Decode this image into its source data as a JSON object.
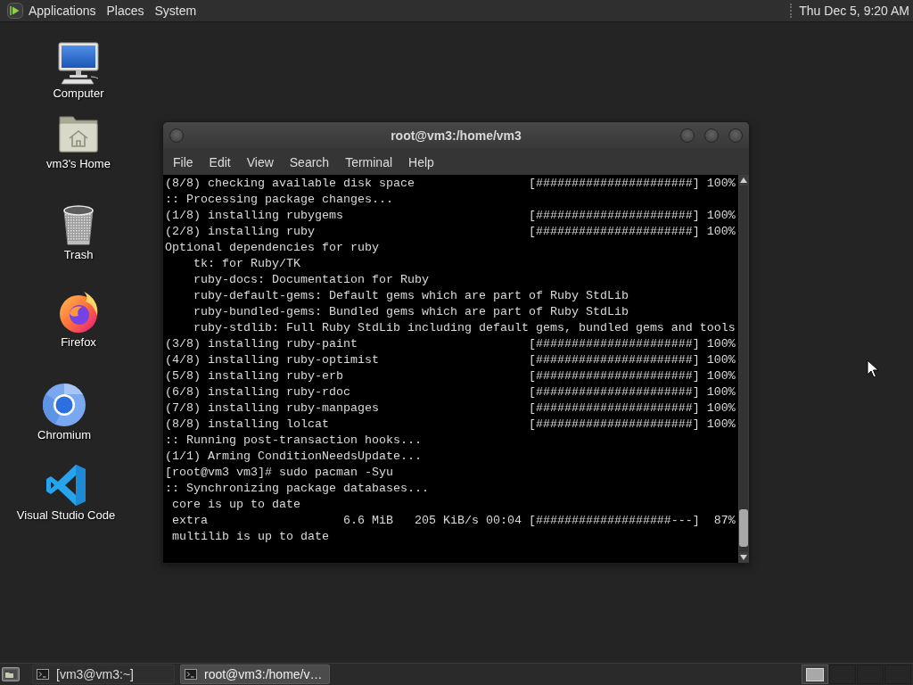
{
  "top_panel": {
    "menus": [
      "Applications",
      "Places",
      "System"
    ],
    "clock": "Thu Dec 5, 9:20 AM"
  },
  "desktop_icons": [
    {
      "kind": "computer",
      "label": "Computer"
    },
    {
      "kind": "home",
      "label": "vm3's Home"
    },
    {
      "kind": "trash",
      "label": "Trash"
    },
    {
      "kind": "firefox",
      "label": "Firefox"
    },
    {
      "kind": "chromium",
      "label": "Chromium"
    },
    {
      "kind": "vscode",
      "label": "Visual Studio Code"
    }
  ],
  "terminal": {
    "title": "root@vm3:/home/vm3",
    "menu": [
      "File",
      "Edit",
      "View",
      "Search",
      "Terminal",
      "Help"
    ],
    "lines": [
      {
        "text": "(8/8) checking available disk space",
        "progress": "[######################] 100%"
      },
      {
        "text": ":: Processing package changes..."
      },
      {
        "text": "(1/8) installing rubygems",
        "progress": "[######################] 100%"
      },
      {
        "text": "(2/8) installing ruby",
        "progress": "[######################] 100%"
      },
      {
        "text": "Optional dependencies for ruby"
      },
      {
        "text": "    tk: for Ruby/TK"
      },
      {
        "text": "    ruby-docs: Documentation for Ruby"
      },
      {
        "text": "    ruby-default-gems: Default gems which are part of Ruby StdLib"
      },
      {
        "text": "    ruby-bundled-gems: Bundled gems which are part of Ruby StdLib"
      },
      {
        "text": "    ruby-stdlib: Full Ruby StdLib including default gems, bundled gems and tools"
      },
      {
        "text": "(3/8) installing ruby-paint",
        "progress": "[######################] 100%"
      },
      {
        "text": "(4/8) installing ruby-optimist",
        "progress": "[######################] 100%"
      },
      {
        "text": "(5/8) installing ruby-erb",
        "progress": "[######################] 100%"
      },
      {
        "text": "(6/8) installing ruby-rdoc",
        "progress": "[######################] 100%"
      },
      {
        "text": "(7/8) installing ruby-manpages",
        "progress": "[######################] 100%"
      },
      {
        "text": "(8/8) installing lolcat",
        "progress": "[######################] 100%"
      },
      {
        "text": ":: Running post-transaction hooks..."
      },
      {
        "text": "(1/1) Arming ConditionNeedsUpdate..."
      },
      {
        "text": "[root@vm3 vm3]# sudo pacman -Syu"
      },
      {
        "text": ":: Synchronizing package databases..."
      },
      {
        "text": " core is up to date"
      },
      {
        "text": " extra                   6.6 MiB   205 KiB/s 00:04",
        "progress": "[###################---]  87%"
      },
      {
        "text": " multilib is up to date"
      }
    ]
  },
  "taskbar": {
    "tasks": [
      {
        "label": "[vm3@vm3:~]",
        "selected": false
      },
      {
        "label": "root@vm3:/home/v…",
        "selected": true
      }
    ],
    "workspaces": [
      {
        "selected": true
      },
      {
        "selected": false
      },
      {
        "selected": false
      },
      {
        "selected": false
      }
    ]
  }
}
